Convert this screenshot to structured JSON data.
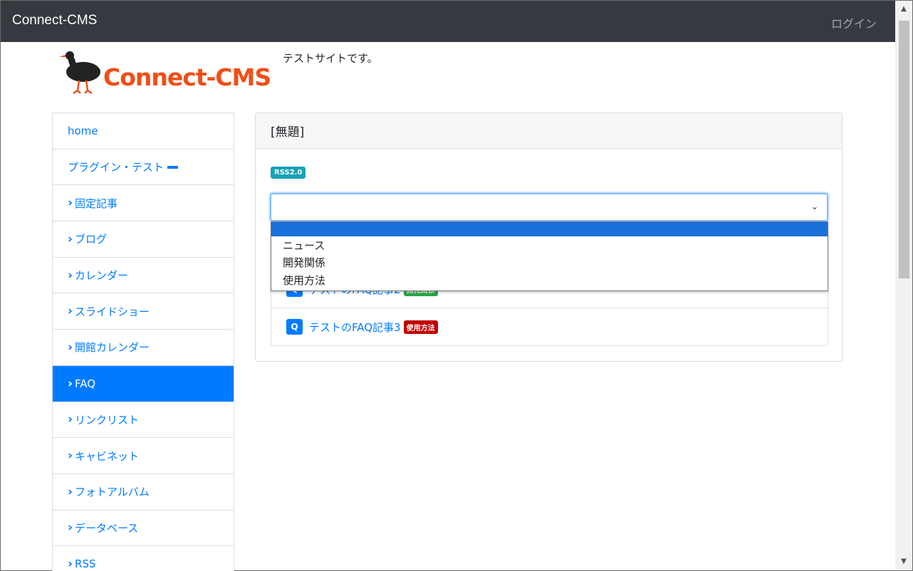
{
  "navbar": {
    "brand": "Connect-CMS",
    "login": "ログイン"
  },
  "header": {
    "logo_text": "Connect-CMS",
    "tagline": "テストサイトです。"
  },
  "sidebar": {
    "items": [
      {
        "label": "home",
        "prefix": "",
        "active": false
      },
      {
        "label": "プラグイン・テスト",
        "prefix": "",
        "active": false
      },
      {
        "label": "固定記事",
        "prefix": "›",
        "active": false
      },
      {
        "label": "ブログ",
        "prefix": "›",
        "active": false
      },
      {
        "label": "カレンダー",
        "prefix": "›",
        "active": false
      },
      {
        "label": "スライドショー",
        "prefix": "›",
        "active": false
      },
      {
        "label": "開館カレンダー",
        "prefix": "›",
        "active": false
      },
      {
        "label": "FAQ",
        "prefix": "›",
        "active": true
      },
      {
        "label": "リンクリスト",
        "prefix": "›",
        "active": false
      },
      {
        "label": "キャビネット",
        "prefix": "›",
        "active": false
      },
      {
        "label": "フォトアルバム",
        "prefix": "›",
        "active": false
      },
      {
        "label": "データベース",
        "prefix": "›",
        "active": false
      },
      {
        "label": "RSS",
        "prefix": "›",
        "active": false
      }
    ]
  },
  "main": {
    "card_title": "[無題]",
    "rss_badge": "RSS2.0",
    "select_value": "",
    "dropdown_options": [
      "",
      "ニュース",
      "開発関係",
      "使用方法"
    ],
    "faq_items": [
      {
        "q": "Q",
        "title": "テストのFAQ記事2",
        "category": "開発関係",
        "category_color": "#28a745"
      },
      {
        "q": "Q",
        "title": "テストのFAQ記事3",
        "category": "使用方法",
        "category_color": "#c20000"
      }
    ]
  },
  "colors": {
    "navbar": "#343a40",
    "accent": "#007bff",
    "logo": "#f04e16",
    "rss": "#17a2b8"
  }
}
